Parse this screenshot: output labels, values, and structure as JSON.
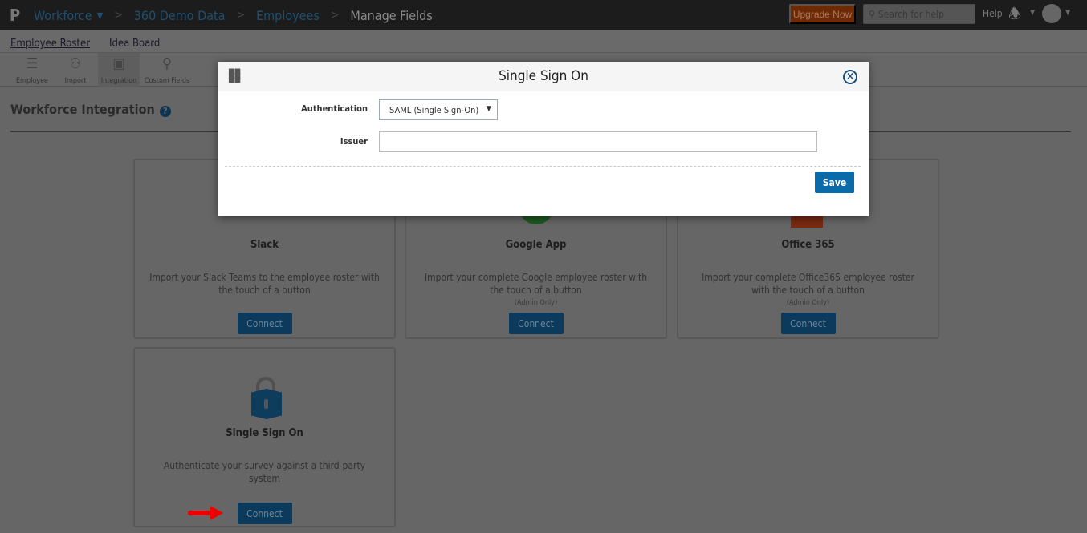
{
  "header": {
    "logo": "P",
    "breadcrumbs": [
      "Workforce",
      "360 Demo Data",
      "Employees",
      "Manage Fields"
    ],
    "upgrade": "Upgrade Now",
    "search_placeholder": "Search for help",
    "help": "Help"
  },
  "subnav": {
    "items": [
      "Employee Roster",
      "Idea Board"
    ]
  },
  "toolbar": {
    "items": [
      "Employee",
      "Import",
      "Integration",
      "Custom Fields"
    ]
  },
  "page": {
    "title": "Workforce Integration",
    "help_icon": "?"
  },
  "cards": [
    {
      "title": "Slack",
      "desc": "Import your Slack Teams to the employee roster with the touch of a button",
      "note": "",
      "button": "Connect"
    },
    {
      "title": "Google App",
      "desc": "Import your complete Google employee roster with the touch of a button",
      "note": "(Admin Only)",
      "button": "Connect"
    },
    {
      "title": "Office 365",
      "desc": "Import your complete Office365 employee roster with the touch of a button",
      "note": "(Admin Only)",
      "button": "Connect"
    },
    {
      "title": "Single Sign On",
      "desc": "Authenticate your survey against a third-party system",
      "note": "",
      "button": "Connect"
    }
  ],
  "modal": {
    "title": "Single Sign On",
    "auth_label": "Authentication",
    "auth_value": "SAML (Single Sign-On)",
    "issuer_label": "Issuer",
    "issuer_value": "",
    "save": "Save"
  }
}
